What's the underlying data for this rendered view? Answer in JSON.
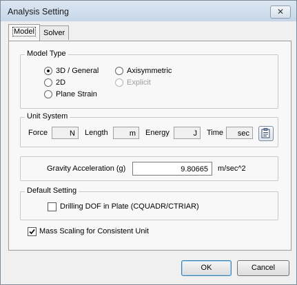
{
  "window": {
    "title": "Analysis Setting",
    "close_glyph": "✕"
  },
  "tabs": [
    {
      "label": "Model",
      "active": true
    },
    {
      "label": "Solver",
      "active": false
    }
  ],
  "model_type": {
    "title": "Model Type",
    "options": [
      {
        "label": "3D / General",
        "checked": true,
        "enabled": true
      },
      {
        "label": "Axisymmetric",
        "checked": false,
        "enabled": true
      },
      {
        "label": "2D",
        "checked": false,
        "enabled": true
      },
      {
        "label": "Explicit",
        "checked": false,
        "enabled": false
      },
      {
        "label": "Plane Strain",
        "checked": false,
        "enabled": true
      }
    ]
  },
  "unit_system": {
    "title": "Unit System",
    "force": {
      "label": "Force",
      "value": "N"
    },
    "length": {
      "label": "Length",
      "value": "m"
    },
    "energy": {
      "label": "Energy",
      "value": "J"
    },
    "time": {
      "label": "Time",
      "value": "sec"
    },
    "button_icon": "clipboard-icon"
  },
  "gravity": {
    "label": "Gravity Acceleration (g)",
    "value": "9.80665",
    "unit": "m/sec^2"
  },
  "default_setting": {
    "title": "Default Setting",
    "drilling_dof": {
      "label": "Drilling DOF in Plate (CQUADR/CTRIAR)",
      "checked": false
    }
  },
  "mass_scaling": {
    "label": "Mass Scaling for Consistent Unit",
    "checked": true
  },
  "buttons": {
    "ok": "OK",
    "cancel": "Cancel"
  }
}
